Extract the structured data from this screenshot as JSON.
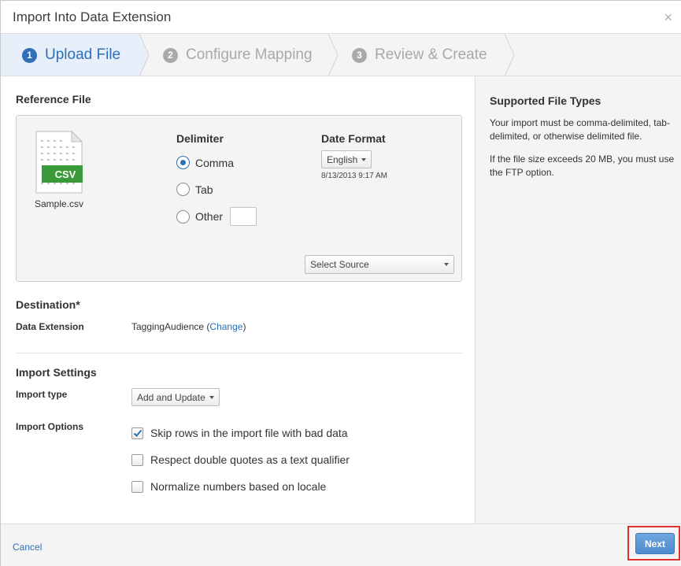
{
  "dialog": {
    "title": "Import Into Data Extension",
    "close_glyph": "×"
  },
  "wizard": {
    "steps": [
      {
        "number": "1",
        "label": "Upload File",
        "active": true
      },
      {
        "number": "2",
        "label": "Configure Mapping",
        "active": false
      },
      {
        "number": "3",
        "label": "Review & Create",
        "active": false
      }
    ]
  },
  "reference": {
    "title": "Reference File",
    "file_badge": "CSV",
    "file_name": "Sample.csv",
    "delimiter": {
      "title": "Delimiter",
      "options": [
        "Comma",
        "Tab",
        "Other"
      ],
      "selected": "Comma"
    },
    "date_format": {
      "title": "Date Format",
      "selected": "English",
      "sample": "8/13/2013 9:17 AM"
    },
    "source_select": "Select Source"
  },
  "destination": {
    "title": "Destination*",
    "label": "Data Extension",
    "value": "TaggingAudience",
    "change_open": "(",
    "change_link": "Change",
    "change_close": ")"
  },
  "settings": {
    "title": "Import Settings",
    "type_label": "Import type",
    "type_value": "Add and Update",
    "options_label": "Import Options",
    "options": [
      {
        "label": "Skip rows in the import file with bad data",
        "checked": true
      },
      {
        "label": "Respect double quotes as a text qualifier",
        "checked": false
      },
      {
        "label": "Normalize numbers based on locale",
        "checked": false
      }
    ]
  },
  "sidebar": {
    "title": "Supported File Types",
    "p1": "Your import must be comma-delimited, tab-delimited, or otherwise delimited file.",
    "p2": "If the file size exceeds 20 MB, you must use the FTP option."
  },
  "footer": {
    "cancel": "Cancel",
    "next": "Next"
  },
  "colors": {
    "accent": "#2e6fb7",
    "csv_badge": "#3a9a3a",
    "highlight": "#e0312f"
  }
}
